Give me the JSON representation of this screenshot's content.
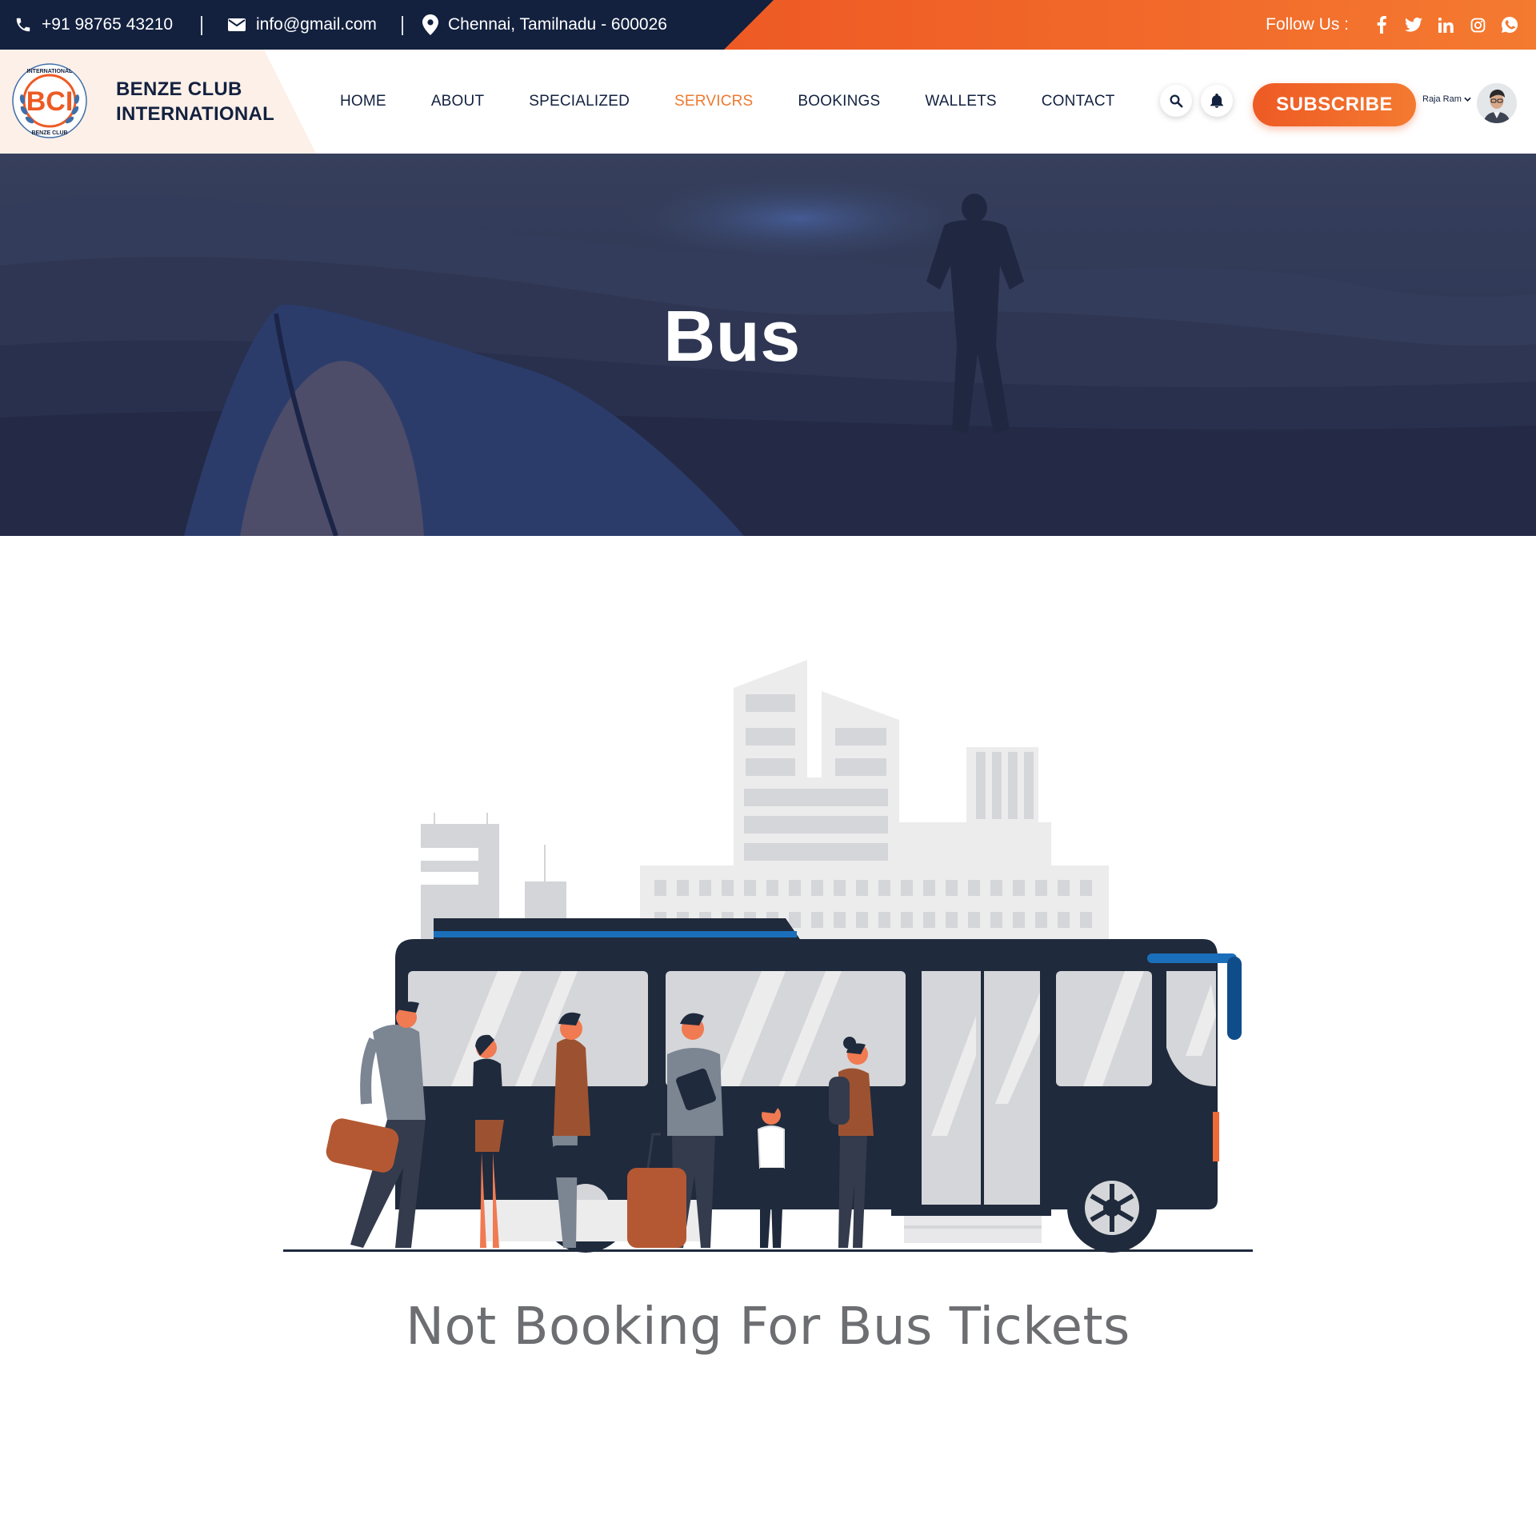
{
  "topbar": {
    "phone": "+91 98765 43210",
    "email": "info@gmail.com",
    "address": "Chennai, Tamilnadu - 600026",
    "follow_label": "Follow Us :",
    "social_icons": [
      "facebook-icon",
      "twitter-icon",
      "linkedin-icon",
      "instagram-icon",
      "whatsapp-icon"
    ]
  },
  "brand": {
    "name_line1": "BENZE CLUB",
    "name_line2": "INTERNATIONAL",
    "logo_text": "BCI",
    "logo_ring_top": "INTERNATIONAL",
    "logo_ring_bottom": "BENZE CLUB"
  },
  "nav": {
    "items": [
      {
        "label": "HOME",
        "active": false
      },
      {
        "label": "ABOUT",
        "active": false
      },
      {
        "label": "SPECIALIZED",
        "active": false
      },
      {
        "label": "SERVICRS",
        "active": true
      },
      {
        "label": "BOOKINGS",
        "active": false
      },
      {
        "label": "WALLETS",
        "active": false
      },
      {
        "label": "CONTACT",
        "active": false
      }
    ],
    "subscribe_label": "SUBSCRIBE",
    "user_name": "Raja Ram"
  },
  "hero": {
    "title": "Bus"
  },
  "content": {
    "empty_message": "Not Booking For Bus Tickets"
  },
  "colors": {
    "navy": "#13213f",
    "orange": "#ee5a24",
    "orange_light": "#f47a30",
    "active_link": "#ee7a2f",
    "message_gray": "#6d6e71"
  }
}
